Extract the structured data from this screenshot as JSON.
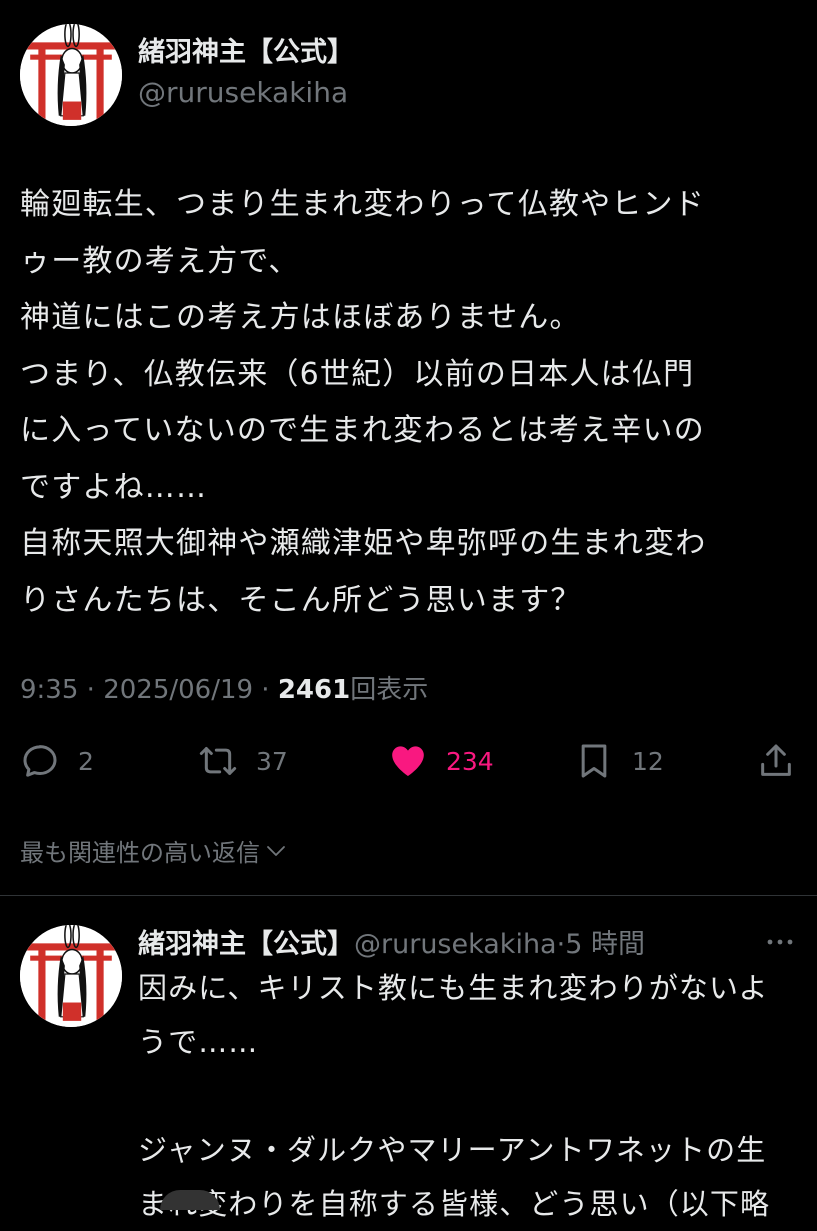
{
  "main_tweet": {
    "author_name": "緒羽神主【公式】",
    "author_handle": "@rurusekakiha",
    "avatar_text": "緒羽神主",
    "body_lines": [
      "輪廻転生、つまり生まれ変わりって仏教やヒンド",
      "ゥー教の考え方で、",
      "神道にはこの考え方はほぼありません。",
      "つまり、仏教伝来（6世紀）以前の日本人は仏門",
      "に入っていないので生まれ変わるとは考え辛いの",
      "ですよね……",
      "自称天照大御神や瀬織津姫や卑弥呼の生まれ変わ",
      "りさんたちは、そこん所どう思います？"
    ],
    "time": "9:35",
    "date": "2025/06/19",
    "views_count": "2461",
    "views_label": "回表示",
    "separator": " · ",
    "actions": {
      "reply_count": "2",
      "retweet_count": "37",
      "like_count": "234",
      "bookmark_count": "12"
    }
  },
  "replies_sort_label": "最も関連性の高い返信",
  "reply": {
    "author_name": "緒羽神主【公式】",
    "author_handle": "@rurusekakiha",
    "separator": "·",
    "time_ago": "5 時間",
    "body_lines": [
      "因みに、キリスト教にも生まれ変わりがないよ",
      "うで……",
      "",
      "ジャンヌ・ダルクやマリーアントワネットの生",
      "まれ変わりを自称する皆様、どう思い（以下略"
    ]
  },
  "colors": {
    "background": "#000000",
    "text_primary": "#e7e9ea",
    "text_secondary": "#71767b",
    "like_active": "#f91880",
    "divider": "#2f3336",
    "torii_red": "#d0302a"
  },
  "icons": [
    "reply-icon",
    "retweet-icon",
    "heart-icon",
    "bookmark-icon",
    "share-icon",
    "chevron-down-icon",
    "more-icon"
  ]
}
